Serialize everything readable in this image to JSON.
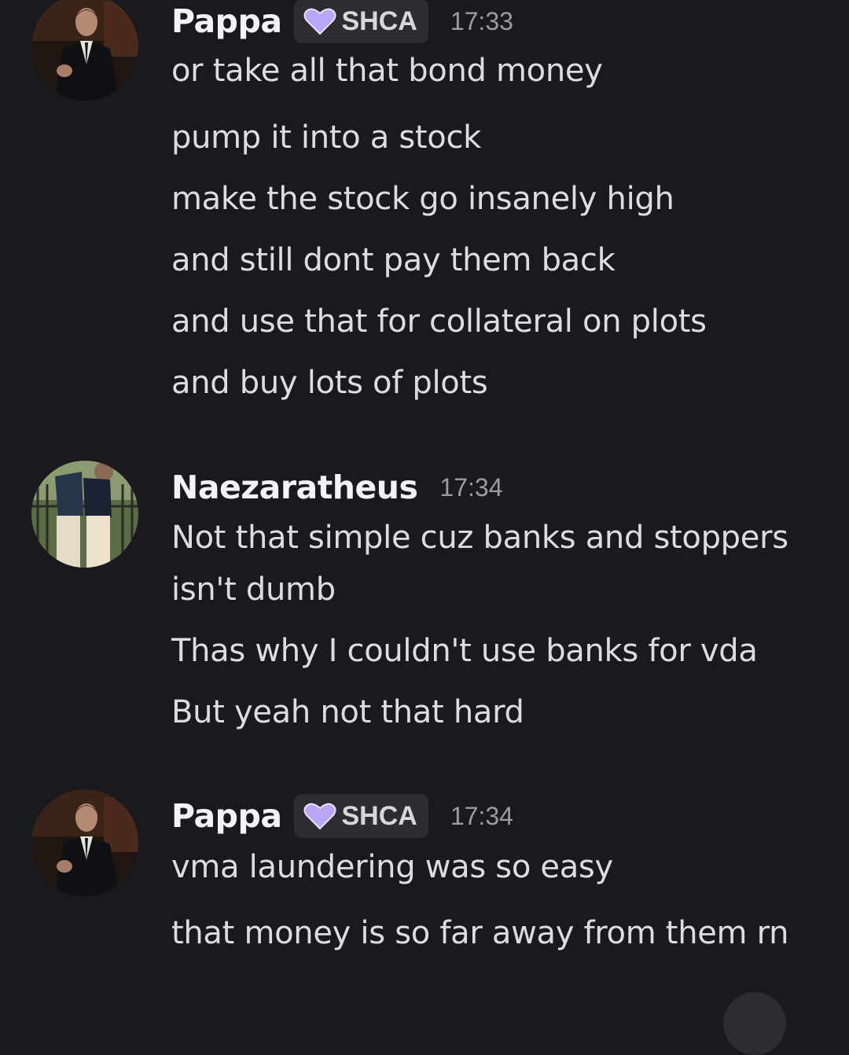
{
  "messages": [
    {
      "author": "Pappa",
      "tag": "SHCA",
      "time": "17:33",
      "lines": [
        "or take all that bond money",
        "pump it into a stock",
        "make the stock go insanely high",
        "and still dont pay them back",
        "and use that for collateral on plots",
        "and buy lots of plots"
      ]
    },
    {
      "author": "Naezaratheus",
      "time": "17:34",
      "lines": [
        "Not that simple cuz banks and stoppers",
        "isn't dumb",
        "Thas why I couldn't use banks for vda",
        "But yeah not that hard"
      ]
    },
    {
      "author": "Pappa",
      "tag": "SHCA",
      "time": "17:34",
      "lines": [
        "vma laundering was so easy",
        "that money is so far away from them rn"
      ]
    }
  ],
  "colors": {
    "background": "#1a1a1e",
    "tag_background": "#2b2d31",
    "tag_heart": "#b9a6f5",
    "username": "#f2f3f5",
    "message_text": "#dbdee1",
    "timestamp": "#9a9ca3"
  },
  "icons": {
    "tag_icon": "heart-icon"
  }
}
